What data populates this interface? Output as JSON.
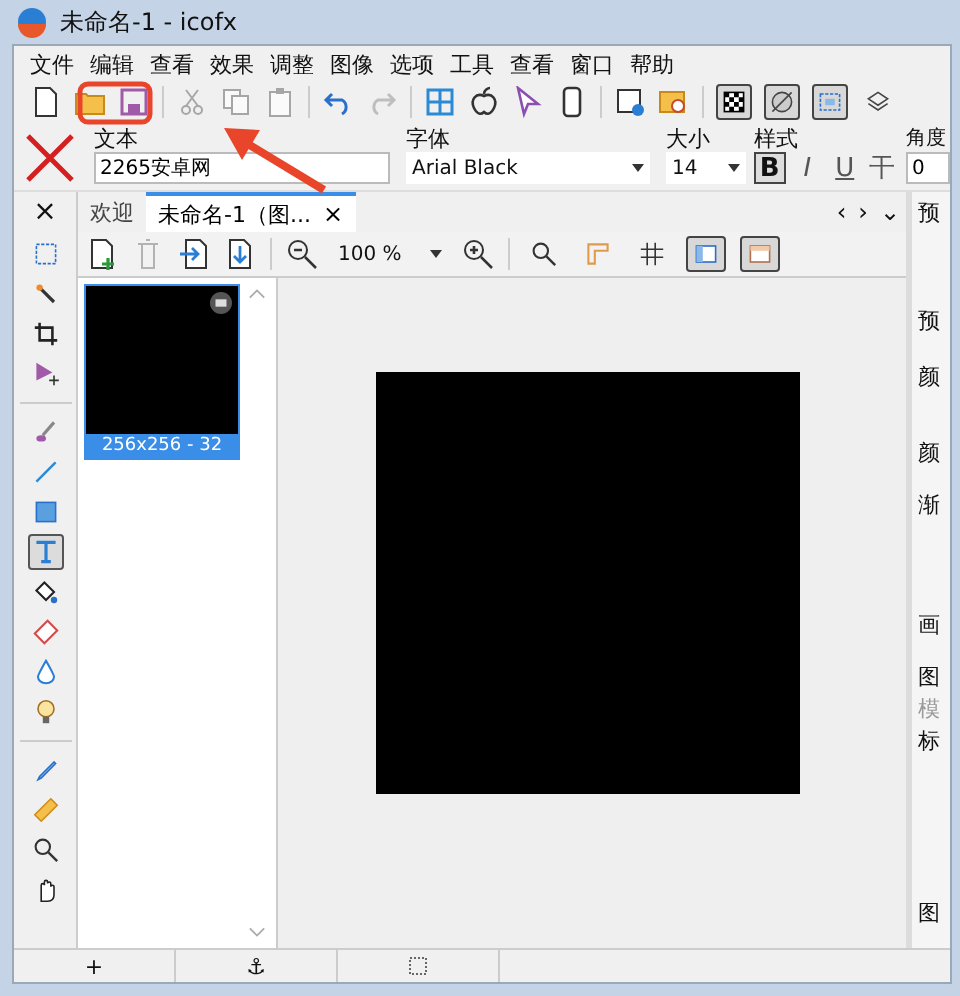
{
  "window": {
    "title": "未命名-1 - icofx"
  },
  "menu": [
    "文件",
    "编辑",
    "查看",
    "效果",
    "调整",
    "图像",
    "选项",
    "工具",
    "查看",
    "窗口",
    "帮助"
  ],
  "view_toggles": [
    {
      "on": true
    },
    {
      "on": true
    },
    {
      "on": true
    },
    {
      "on": false
    }
  ],
  "text_options": {
    "text_label": "文本",
    "text_value": "2265安卓网",
    "font_label": "字体",
    "font_value": "Arial Black",
    "size_label": "大小",
    "size_value": "14",
    "style_label": "样式",
    "styles": [
      {
        "label": "B",
        "on": true
      },
      {
        "label": "I",
        "on": false
      },
      {
        "label": "U",
        "on": false
      },
      {
        "label": "干",
        "on": false
      }
    ],
    "angle_label": "角度",
    "angle_value": "0"
  },
  "panel_close": "×",
  "doc_tabs": [
    {
      "label": "欢迎",
      "selected": false,
      "closable": false
    },
    {
      "label": "未命名-1（图...",
      "selected": true,
      "closable": true
    }
  ],
  "tab_close": "×",
  "tab_nav": [
    "‹",
    "›",
    "⌄"
  ],
  "tools": [
    {
      "selected": false
    },
    {
      "selected": false
    },
    {
      "selected": false
    },
    {
      "selected": false
    },
    {
      "selected": false
    },
    {
      "selected": false
    },
    {
      "selected": false
    },
    {
      "selected": true
    },
    {
      "selected": false
    },
    {
      "selected": false
    },
    {
      "selected": false
    },
    {
      "selected": false
    },
    {
      "selected": false
    },
    {
      "selected": false
    },
    {
      "selected": false
    },
    {
      "selected": false
    }
  ],
  "zoom": "100 %",
  "doc_toggles": [
    {
      "on": false
    },
    {
      "on": false
    },
    {
      "on": false
    },
    {
      "on": true
    },
    {
      "on": true
    }
  ],
  "thumbnails": [
    {
      "label": "256x256 - 32",
      "selected": true
    }
  ],
  "right_panel": [
    "预",
    "预",
    "颜",
    "颜",
    "渐",
    "画",
    "图",
    "模",
    "标",
    "图"
  ],
  "status": [
    "+",
    "⚓"
  ]
}
